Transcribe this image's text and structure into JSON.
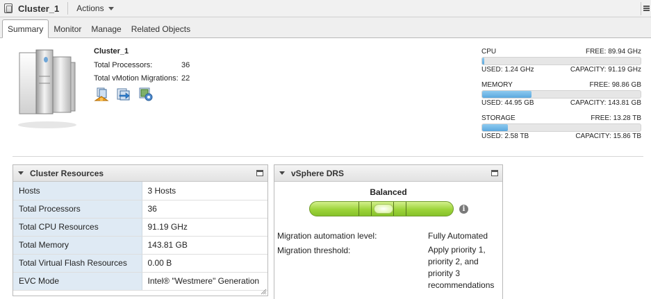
{
  "header": {
    "title": "Cluster_1",
    "actions_label": "Actions"
  },
  "tabs": [
    {
      "label": "Summary"
    },
    {
      "label": "Monitor"
    },
    {
      "label": "Manage"
    },
    {
      "label": "Related Objects"
    }
  ],
  "summary": {
    "name": "Cluster_1",
    "total_processors_label": "Total Processors:",
    "total_processors_value": "36",
    "vmotion_label": "Total vMotion Migrations:",
    "vmotion_value": "22"
  },
  "resources": {
    "cpu": {
      "label": "CPU",
      "free": "FREE: 89.94 GHz",
      "used": "USED: 1.24 GHz",
      "capacity": "CAPACITY: 91.19 GHz",
      "used_fraction": 0.014
    },
    "memory": {
      "label": "MEMORY",
      "free": "FREE: 98.86 GB",
      "used": "USED: 44.95 GB",
      "capacity": "CAPACITY: 143.81 GB",
      "used_fraction": 0.313
    },
    "storage": {
      "label": "STORAGE",
      "free": "FREE: 13.28 TB",
      "used": "USED: 2.58 TB",
      "capacity": "CAPACITY: 15.86 TB",
      "used_fraction": 0.163
    }
  },
  "cluster_resources": {
    "title": "Cluster Resources",
    "rows": [
      {
        "key": "Hosts",
        "value": "3 Hosts"
      },
      {
        "key": "Total Processors",
        "value": "36"
      },
      {
        "key": "Total CPU Resources",
        "value": "91.19 GHz"
      },
      {
        "key": "Total Memory",
        "value": "143.81 GB"
      },
      {
        "key": "Total Virtual Flash Resources",
        "value": "0.00 B"
      },
      {
        "key": "EVC Mode",
        "value": "Intel® \"Westmere\" Generation"
      }
    ]
  },
  "drs": {
    "title": "vSphere DRS",
    "status": "Balanced",
    "automation_label": "Migration automation level:",
    "automation_value": "Fully Automated",
    "threshold_label": "Migration threshold:",
    "threshold_lines": [
      "Apply priority 1,",
      "priority 2, and",
      "priority 3",
      "recommendations"
    ]
  }
}
